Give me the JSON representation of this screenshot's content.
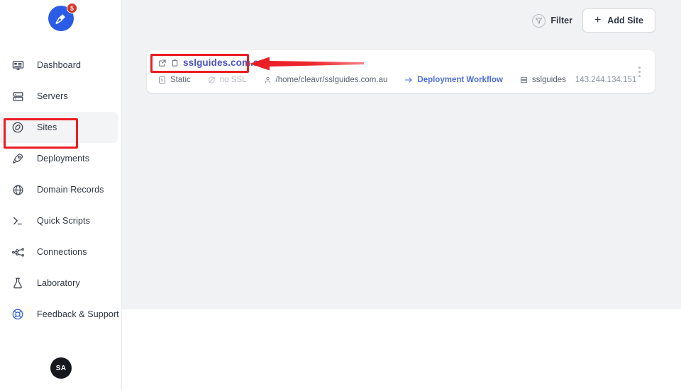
{
  "app": {
    "logo_badge_count": "5",
    "user_initials": "SA"
  },
  "sidebar": {
    "items": [
      {
        "label": "Dashboard",
        "icon": "dashboard-icon",
        "active": false
      },
      {
        "label": "Servers",
        "icon": "servers-icon",
        "active": false
      },
      {
        "label": "Sites",
        "icon": "compass-icon",
        "active": true
      },
      {
        "label": "Deployments",
        "icon": "rocket-icon",
        "active": false
      },
      {
        "label": "Domain Records",
        "icon": "globe-icon",
        "active": false
      },
      {
        "label": "Quick Scripts",
        "icon": "terminal-icon",
        "active": false
      },
      {
        "label": "Connections",
        "icon": "connections-icon",
        "active": false
      },
      {
        "label": "Laboratory",
        "icon": "flask-icon",
        "active": false
      },
      {
        "label": "Feedback & Support",
        "icon": "lifebuoy-icon",
        "active": false
      }
    ]
  },
  "toolbar": {
    "filter_label": "Filter",
    "add_site_label": "Add Site",
    "add_site_plus": "+"
  },
  "sites": [
    {
      "name": "sslguides.com.au",
      "type": "Static",
      "ssl": "no SSL",
      "path": "/home/cleavr/sslguides.com.au",
      "workflow": "Deployment Workflow",
      "server_name": "sslguides",
      "server_ip": "143.244.134.151"
    }
  ],
  "colors": {
    "accent_blue": "#4c53c4",
    "link_blue": "#4c6fe0",
    "annotation_red": "#ec1c24",
    "brand_blue": "#2b5ce6",
    "badge_red": "#d93025",
    "canvas_gray": "#f1f2f4"
  }
}
